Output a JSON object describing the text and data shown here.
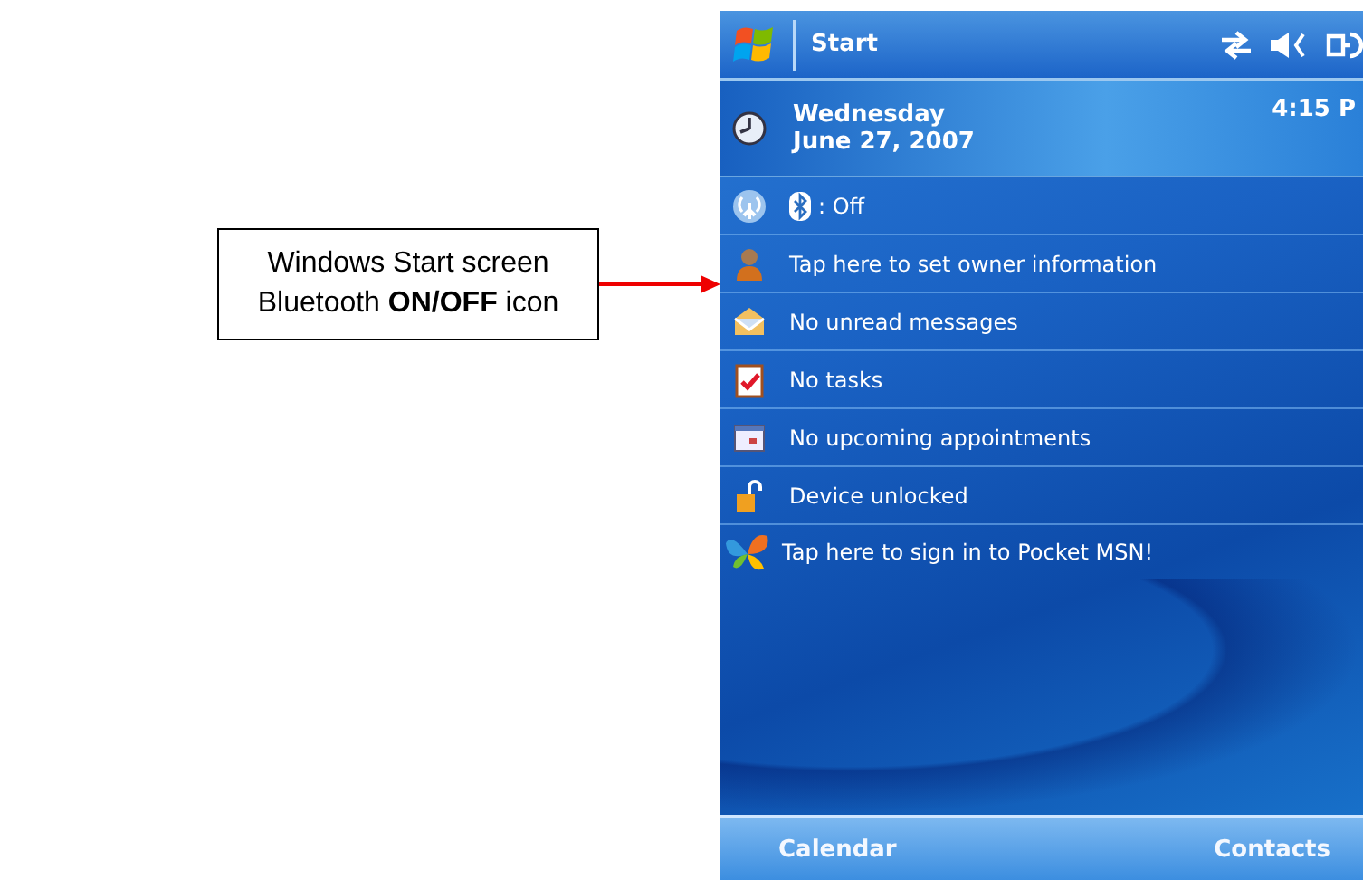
{
  "callout": {
    "lines": [
      "Windows Start screen",
      "Bluetooth **ON/OFF** icon"
    ]
  },
  "title_bar": {
    "title": "Start"
  },
  "date": {
    "weekday": "Wednesday",
    "date": "June 27, 2007",
    "time": "4:15 P"
  },
  "items": [
    {
      "kind": "bluetooth",
      "text": ": Off"
    },
    {
      "kind": "owner",
      "text": "Tap here to set owner information"
    },
    {
      "kind": "messages",
      "text": "No unread messages"
    },
    {
      "kind": "tasks",
      "text": "No tasks"
    },
    {
      "kind": "calendar",
      "text": "No upcoming appointments"
    },
    {
      "kind": "lock",
      "text": "Device unlocked"
    },
    {
      "kind": "msn",
      "text": "Tap here to sign in to Pocket MSN!"
    }
  ],
  "softkeys": [
    "Calendar",
    "Contacts"
  ]
}
